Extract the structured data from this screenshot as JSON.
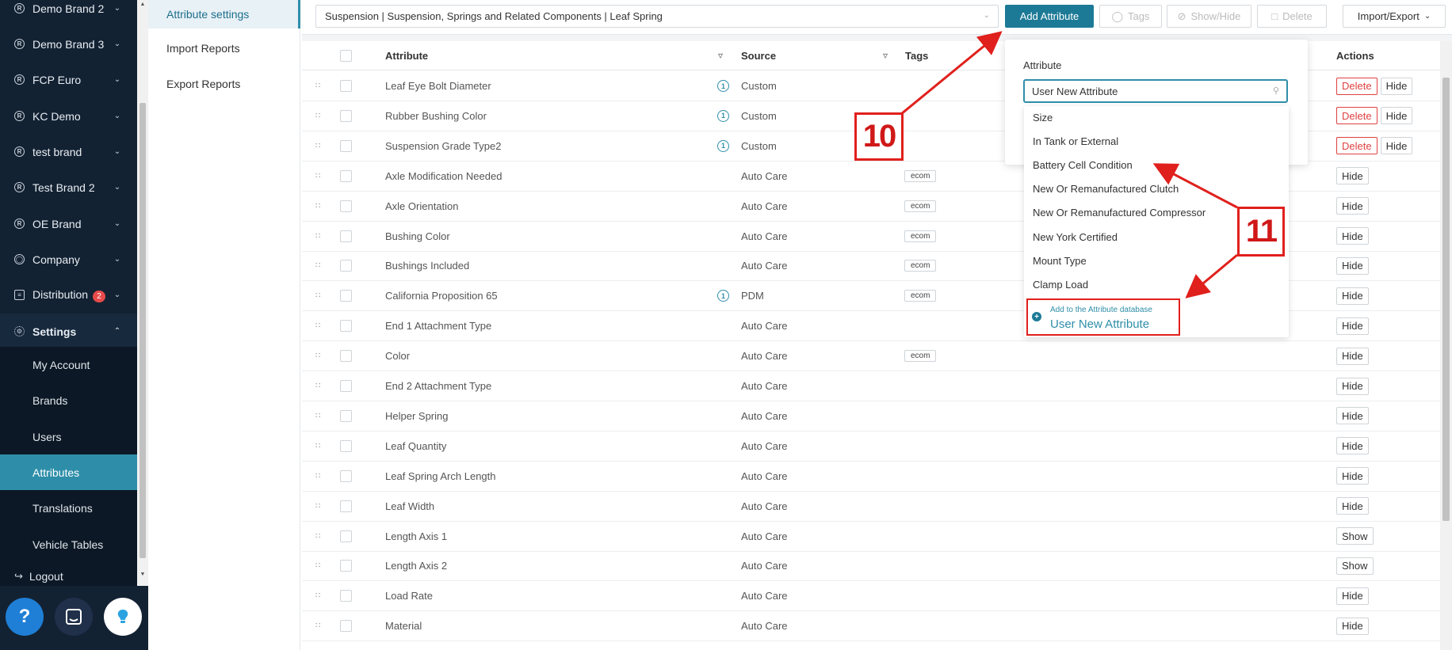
{
  "sidebar": {
    "nav_items": [
      {
        "label": "Demo Brand 2",
        "icon": "R"
      },
      {
        "label": "Demo Brand 3",
        "icon": "R"
      },
      {
        "label": "FCP Euro",
        "icon": "R"
      },
      {
        "label": "KC Demo",
        "icon": "R"
      },
      {
        "label": "test brand",
        "icon": "R"
      },
      {
        "label": "Test Brand 2",
        "icon": "R"
      },
      {
        "label": "OE Brand",
        "icon": "R"
      },
      {
        "label": "Company",
        "icon": "globe-icon"
      },
      {
        "label": "Distribution",
        "icon": "document-icon",
        "badge": "2"
      },
      {
        "label": "Settings",
        "icon": "gear-icon"
      }
    ],
    "settings_submenu": [
      {
        "label": "My Account"
      },
      {
        "label": "Brands"
      },
      {
        "label": "Users"
      },
      {
        "label": "Attributes",
        "active": true
      },
      {
        "label": "Translations"
      },
      {
        "label": "Vehicle Tables"
      }
    ],
    "logout_label": "Logout",
    "help_buttons": [
      "help-icon",
      "chat-icon",
      "lightbulb-icon"
    ]
  },
  "subnav": {
    "items": [
      {
        "label": "Attribute settings",
        "active": true
      },
      {
        "label": "Import Reports"
      },
      {
        "label": "Export Reports"
      }
    ]
  },
  "toolbar": {
    "category": "Suspension | Suspension, Springs and Related Components | Leaf Spring",
    "add_attribute": "Add Attribute",
    "tags": "Tags",
    "show_hide": "Show/Hide",
    "delete": "Delete",
    "import_export": "Import/Export"
  },
  "table": {
    "headers": {
      "attribute": "Attribute",
      "source": "Source",
      "tags": "Tags",
      "actions": "Actions"
    },
    "rows": [
      {
        "attribute": "Leaf Eye Bolt Diameter",
        "info": true,
        "source": "Custom",
        "tag": "",
        "actions": [
          "Delete",
          "Hide"
        ]
      },
      {
        "attribute": "Rubber Bushing Color",
        "info": true,
        "source": "Custom",
        "tag": "",
        "actions": [
          "Delete",
          "Hide"
        ]
      },
      {
        "attribute": "Suspension Grade Type2",
        "info": true,
        "source": "Custom",
        "tag": "",
        "actions": [
          "Delete",
          "Hide"
        ]
      },
      {
        "attribute": "Axle Modification Needed",
        "info": false,
        "source": "Auto Care",
        "tag": "ecom",
        "actions": [
          "Hide"
        ]
      },
      {
        "attribute": "Axle Orientation",
        "info": false,
        "source": "Auto Care",
        "tag": "ecom",
        "actions": [
          "Hide"
        ]
      },
      {
        "attribute": "Bushing Color",
        "info": false,
        "source": "Auto Care",
        "tag": "ecom",
        "actions": [
          "Hide"
        ]
      },
      {
        "attribute": "Bushings Included",
        "info": false,
        "source": "Auto Care",
        "tag": "ecom",
        "actions": [
          "Hide"
        ]
      },
      {
        "attribute": "California Proposition 65",
        "info": true,
        "source": "PDM",
        "tag": "ecom",
        "actions": [
          "Hide"
        ]
      },
      {
        "attribute": "End 1 Attachment Type",
        "info": false,
        "source": "Auto Care",
        "tag": "",
        "actions": [
          "Hide"
        ]
      },
      {
        "attribute": "Color",
        "info": false,
        "source": "Auto Care",
        "tag": "ecom",
        "actions": [
          "Hide"
        ]
      },
      {
        "attribute": "End 2 Attachment Type",
        "info": false,
        "source": "Auto Care",
        "tag": "",
        "actions": [
          "Hide"
        ]
      },
      {
        "attribute": "Helper Spring",
        "info": false,
        "source": "Auto Care",
        "tag": "",
        "actions": [
          "Hide"
        ]
      },
      {
        "attribute": "Leaf Quantity",
        "info": false,
        "source": "Auto Care",
        "tag": "",
        "actions": [
          "Hide"
        ]
      },
      {
        "attribute": "Leaf Spring Arch Length",
        "info": false,
        "source": "Auto Care",
        "tag": "",
        "actions": [
          "Hide"
        ]
      },
      {
        "attribute": "Leaf Width",
        "info": false,
        "source": "Auto Care",
        "tag": "",
        "actions": [
          "Hide"
        ]
      },
      {
        "attribute": "Length Axis 1",
        "info": false,
        "source": "Auto Care",
        "tag": "",
        "actions": [
          "Show"
        ]
      },
      {
        "attribute": "Length Axis 2",
        "info": false,
        "source": "Auto Care",
        "tag": "",
        "actions": [
          "Show"
        ]
      },
      {
        "attribute": "Load Rate",
        "info": false,
        "source": "Auto Care",
        "tag": "",
        "actions": [
          "Hide"
        ]
      },
      {
        "attribute": "Material",
        "info": false,
        "source": "Auto Care",
        "tag": "",
        "actions": [
          "Hide"
        ]
      }
    ]
  },
  "popover": {
    "label": "Attribute",
    "input_value": "User New Attribute",
    "suggestions": [
      "Size",
      "In Tank or External",
      "Battery Cell Condition",
      "New Or Remanufactured Clutch",
      "New Or Remanufactured Compressor",
      "New York Certified",
      "Mount Type",
      "Clamp Load"
    ],
    "add_to_db_label": "Add to the Attribute database",
    "add_to_db_value": "User New Attribute"
  },
  "annotations": {
    "step_10": "10",
    "step_11": "11",
    "color": "#e0201c"
  }
}
